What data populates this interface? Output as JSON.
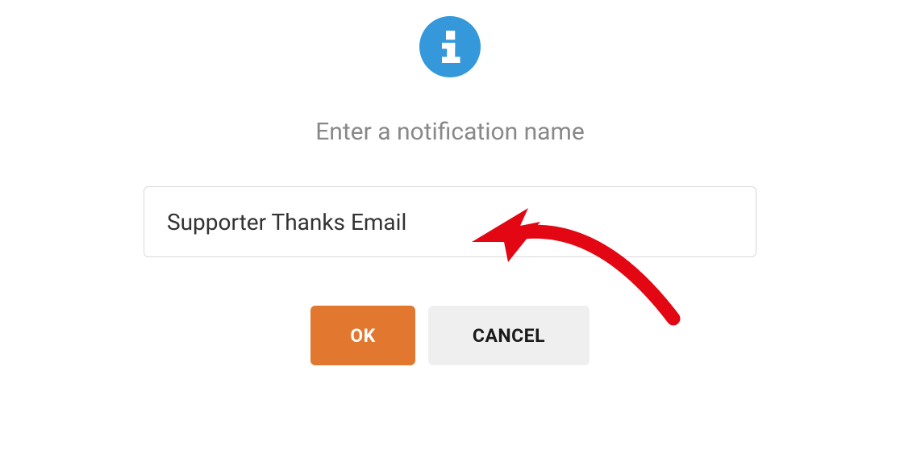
{
  "dialog": {
    "prompt": "Enter a notification name",
    "input_value": "Supporter Thanks Email",
    "ok_label": "OK",
    "cancel_label": "CANCEL"
  },
  "colors": {
    "info_icon_bg": "#3598db",
    "ok_button_bg": "#e27730",
    "cancel_button_bg": "#efefef",
    "annotation": "#e30613"
  }
}
